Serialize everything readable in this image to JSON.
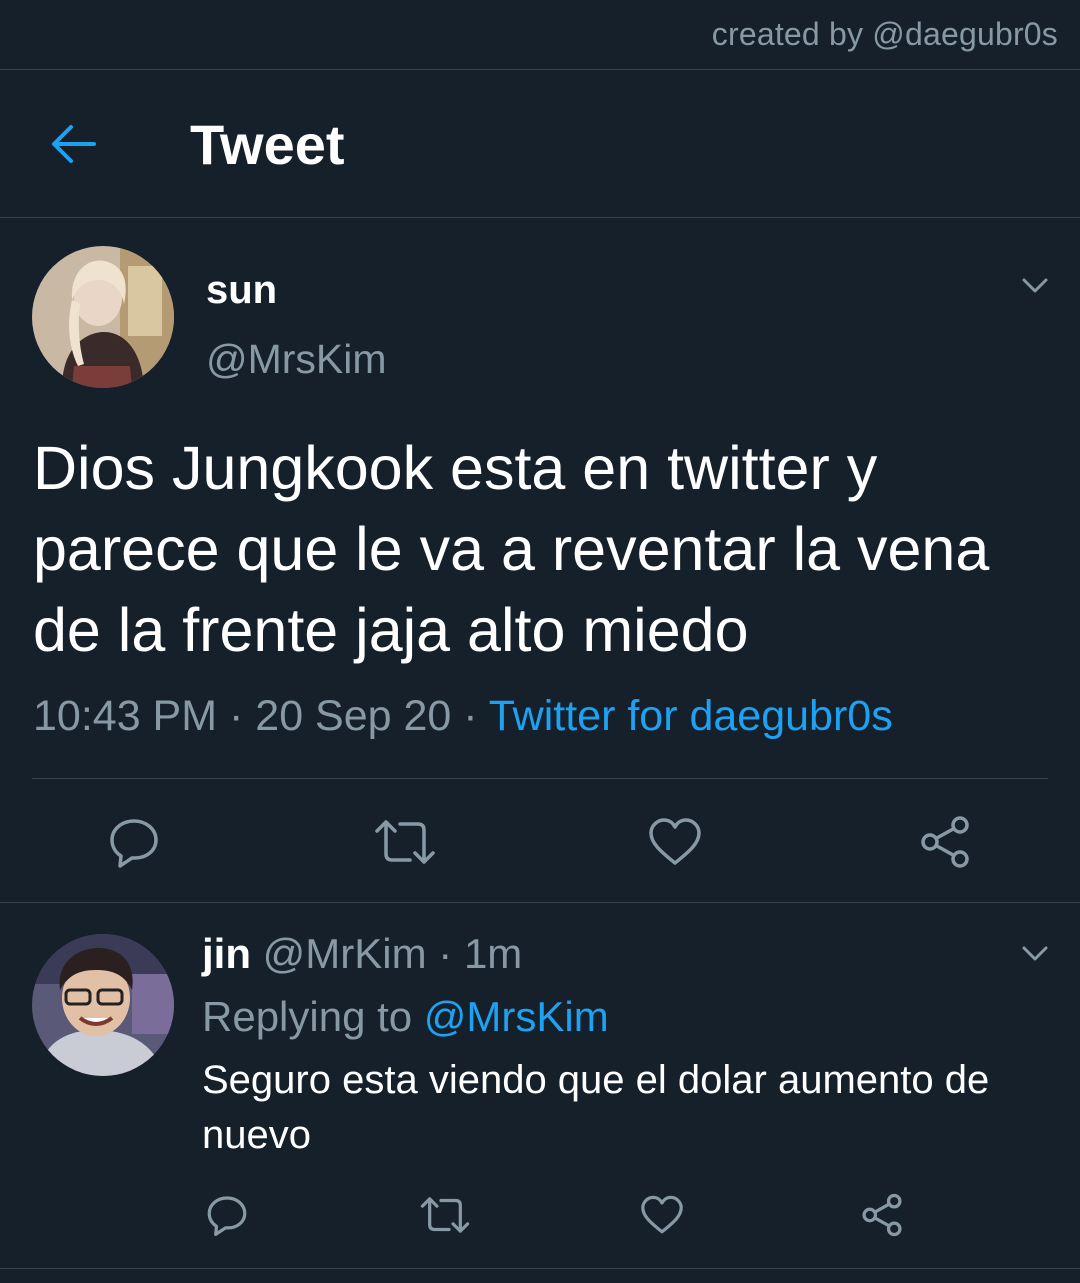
{
  "credit": "created by @daegubr0s",
  "header": {
    "title": "Tweet"
  },
  "tweet": {
    "name": "sun",
    "handle": "@MrsKim",
    "text": "Dios Jungkook esta en twitter y parece que le va a reventar la vena de la frente jaja alto miedo",
    "time": "10:43 PM",
    "sep1": " · ",
    "date": "20 Sep 20",
    "sep2": " · ",
    "source": "Twitter for daegubr0s"
  },
  "reply": {
    "name": "jin",
    "handle": "@MrKim",
    "sep": " · ",
    "age": "1m",
    "replying_label": "Replying to",
    "replying_handle": "@MrsKim",
    "text": "Seguro esta viendo que el dolar aumento de nuevo"
  },
  "icons": [
    "back-arrow-icon",
    "chevron-down-icon",
    "reply-icon",
    "retweet-icon",
    "like-icon",
    "share-icon"
  ],
  "colors": {
    "background": "#15202b",
    "divider": "#38444d",
    "muted": "#8899a6",
    "accent": "#1da1f2"
  }
}
